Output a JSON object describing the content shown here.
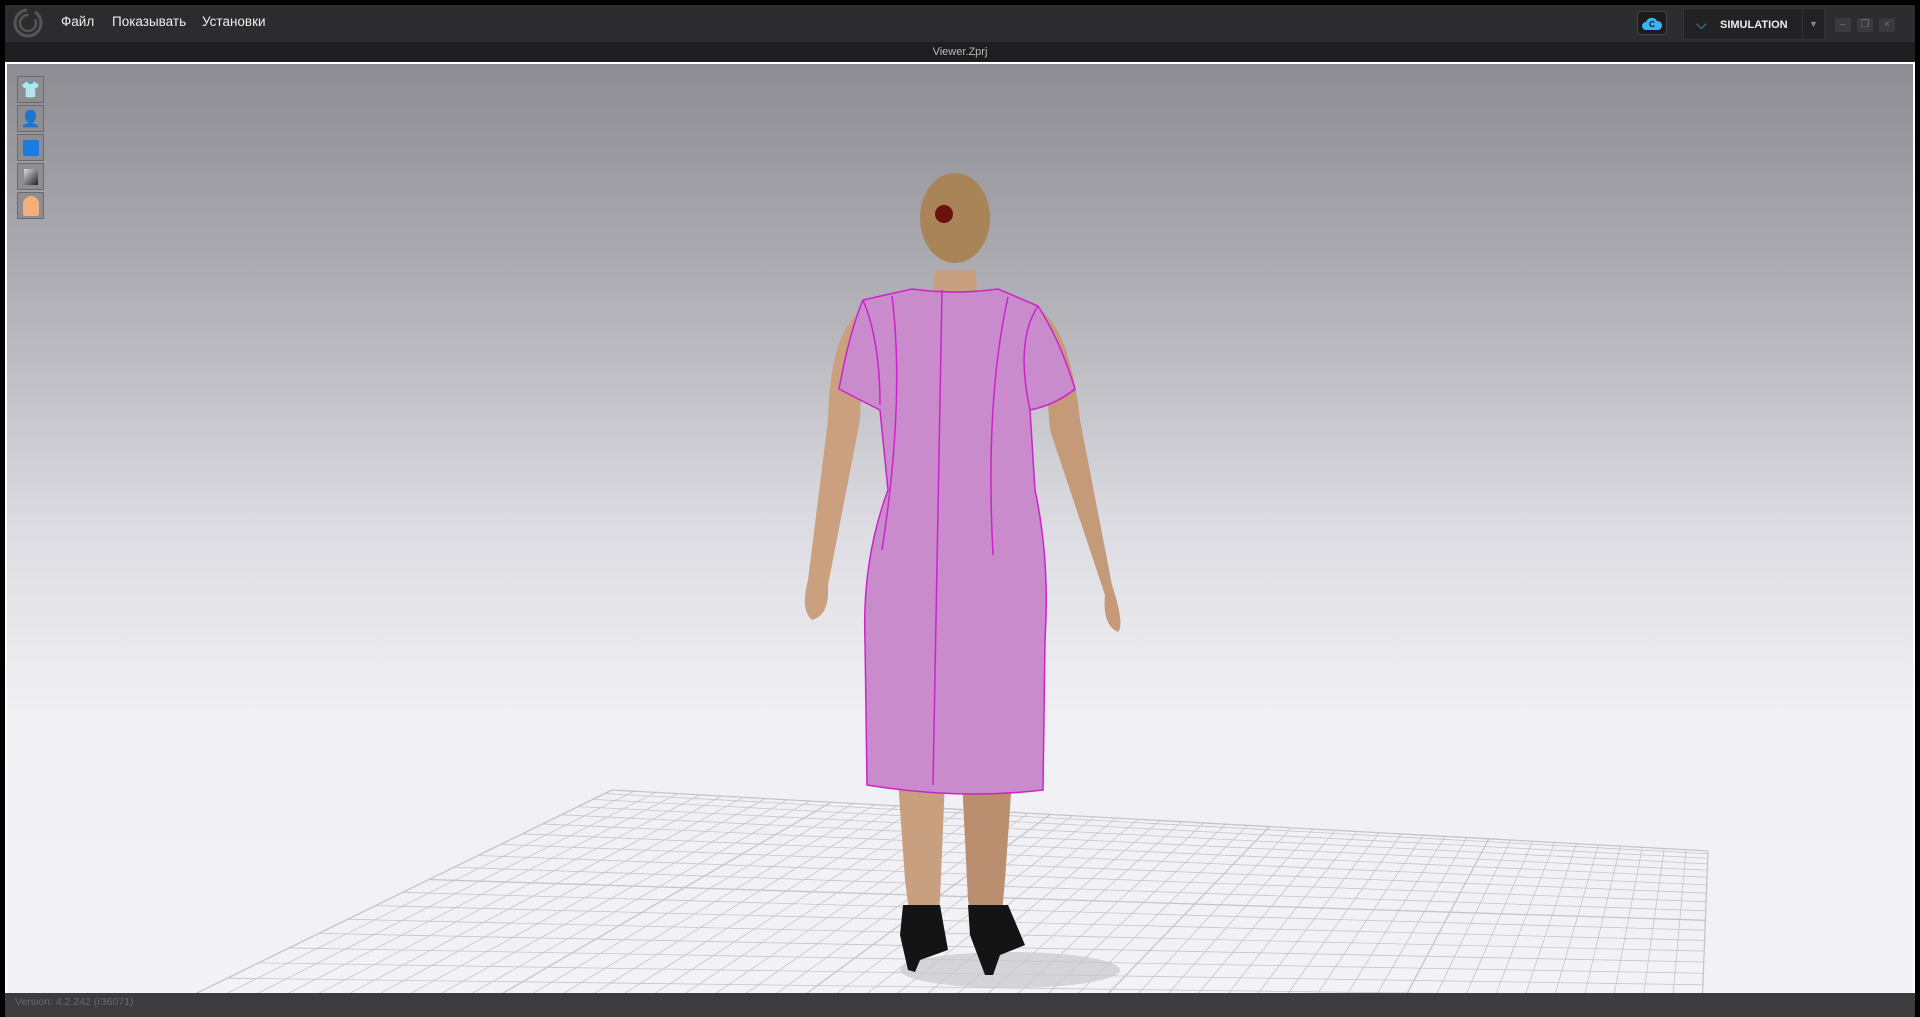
{
  "menu": {
    "items": [
      "Файл",
      "Показывать",
      "Установки"
    ]
  },
  "mode": {
    "label": "SIMULATION"
  },
  "window": {
    "title": "Viewer.Zprj"
  },
  "toolbar": {
    "icons": [
      "garment-visibility-icon",
      "avatar-visibility-icon",
      "fabric-display-icon",
      "texture-display-icon",
      "avatar-display-icon"
    ]
  },
  "status": {
    "version": "Version: 4.2.242 (r36071)"
  },
  "colors": {
    "accent": "#3ab4f2",
    "dress": "#c98bcc",
    "seam": "#cc22cc"
  }
}
